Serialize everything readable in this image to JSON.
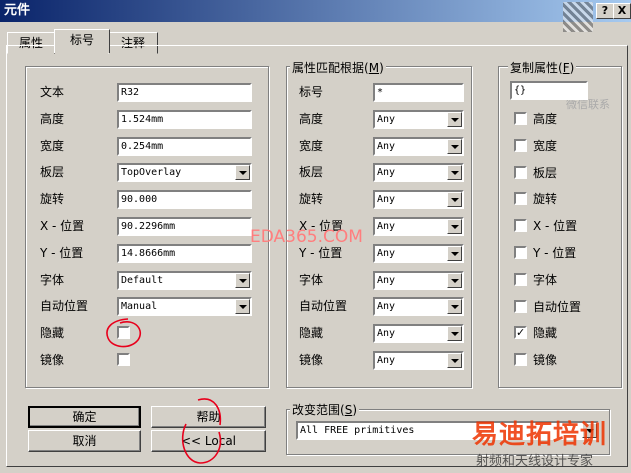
{
  "window": {
    "title": "元件",
    "help_btn": "?",
    "close_btn": "X"
  },
  "tabs": [
    "属性",
    "标号",
    "注释"
  ],
  "left_group": {
    "rows": [
      {
        "label": "文本",
        "type": "text",
        "value": "R32"
      },
      {
        "label": "高度",
        "type": "text",
        "value": "1.524mm"
      },
      {
        "label": "宽度",
        "type": "text",
        "value": "0.254mm"
      },
      {
        "label": "板层",
        "type": "combo",
        "value": "TopOverlay"
      },
      {
        "label": "旋转",
        "type": "text",
        "value": "90.000"
      },
      {
        "label": "X - 位置",
        "type": "text",
        "value": "90.2296mm"
      },
      {
        "label": "Y - 位置",
        "type": "text",
        "value": "14.8666mm"
      },
      {
        "label": "字体",
        "type": "combo",
        "value": "Default"
      },
      {
        "label": "自动位置",
        "type": "combo",
        "value": "Manual"
      },
      {
        "label": "隐藏",
        "type": "check",
        "checked": false
      },
      {
        "label": "镜像",
        "type": "check",
        "checked": false
      }
    ]
  },
  "match_group": {
    "title": "属性匹配根据",
    "hotkey": "M",
    "rows": [
      {
        "label": "标号",
        "value": "*"
      },
      {
        "label": "高度",
        "value": "Any"
      },
      {
        "label": "宽度",
        "value": "Any"
      },
      {
        "label": "板层",
        "value": "Any"
      },
      {
        "label": "旋转",
        "value": "Any"
      },
      {
        "label": "X - 位置",
        "value": "Any"
      },
      {
        "label": "Y - 位置",
        "value": "Any"
      },
      {
        "label": "字体",
        "value": "Any"
      },
      {
        "label": "自动位置",
        "value": "Any"
      },
      {
        "label": "隐藏",
        "value": "Any"
      },
      {
        "label": "镜像",
        "value": "Any"
      }
    ]
  },
  "copy_group": {
    "title": "复制属性",
    "hotkey": "F",
    "value": "{}",
    "rows": [
      {
        "label": "高度",
        "checked": false
      },
      {
        "label": "宽度",
        "checked": false
      },
      {
        "label": "板层",
        "checked": false
      },
      {
        "label": "旋转",
        "checked": false
      },
      {
        "label": "X - 位置",
        "checked": false
      },
      {
        "label": "Y - 位置",
        "checked": false
      },
      {
        "label": "字体",
        "checked": false
      },
      {
        "label": "自动位置",
        "checked": false
      },
      {
        "label": "隐藏",
        "checked": true
      },
      {
        "label": "镜像",
        "checked": false
      }
    ]
  },
  "buttons": {
    "ok": "确定",
    "help": "帮助",
    "cancel": "取消",
    "local": "<< Local"
  },
  "scope_group": {
    "title": "改变范围",
    "hotkey": "S",
    "value": "All FREE primitives"
  },
  "watermarks": {
    "center": "EDA365.COM",
    "corner_main": "易迪拓培训",
    "corner_sub": "射频和天线设计专家",
    "qr_text": "微信联系"
  },
  "colors": {
    "annotation_red": "#e8001c",
    "title_bar": "#0a246a",
    "face": "#d4d0c8"
  }
}
